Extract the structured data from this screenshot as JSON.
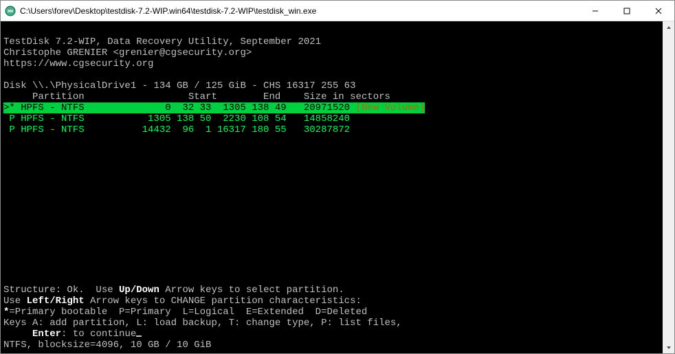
{
  "window": {
    "title": "C:\\Users\\forev\\Desktop\\testdisk-7.2-WIP.win64\\testdisk-7.2-WIP\\testdisk_win.exe"
  },
  "header": {
    "line1": "TestDisk 7.2-WIP, Data Recovery Utility, September 2021",
    "line2": "Christophe GRENIER <grenier@cgsecurity.org>",
    "line3": "https://www.cgsecurity.org"
  },
  "disk_line": "Disk \\\\.\\PhysicalDrive1 - 134 GB / 125 GiB - CHS 16317 255 63",
  "columns_header": "     Partition                  Start        End    Size in sectors",
  "partitions": [
    {
      "selected": true,
      "line": ">* HPFS - NTFS              0  32 33  1305 138 49   20971520 ",
      "label": "[New Volume]"
    },
    {
      "selected": false,
      "line": " P HPFS - NTFS           1305 138 50  2230 108 54   14858240"
    },
    {
      "selected": false,
      "line": " P HPFS - NTFS          14432  96  1 16317 180 55   30287872"
    }
  ],
  "help": {
    "structure_prefix": "Structure: Ok.  Use ",
    "structure_updown": "Up/Down",
    "structure_suffix": " Arrow keys to select partition.",
    "leftright_prefix": "Use ",
    "leftright_key": "Left/Right",
    "leftright_suffix": " Arrow keys to CHANGE partition characteristics:",
    "legend_prefix": "*",
    "legend": "=Primary bootable  P=Primary  L=Logical  E=Extended  D=Deleted",
    "keys_line": "Keys A: add partition, L: load backup, T: change type, P: list files,",
    "enter_prefix": "     ",
    "enter_key": "Enter",
    "enter_suffix": ": to continue",
    "ntfs_line": "NTFS, blocksize=4096, 10 GB / 10 GiB"
  }
}
